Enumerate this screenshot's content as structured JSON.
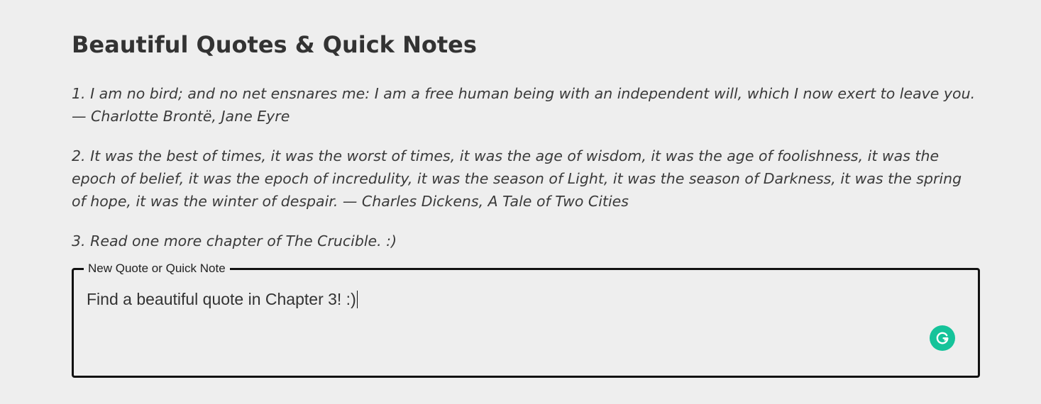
{
  "page": {
    "title": "Beautiful Quotes & Quick Notes"
  },
  "quotes": [
    {
      "number": "1.",
      "text": "I am no bird; and no net ensnares me: I am a free human being with an independent will, which I now exert to leave you. — Charlotte Brontë, Jane Eyre"
    },
    {
      "number": "2.",
      "text": "It was the best of times, it was the worst of times, it was the age of wisdom, it was the age of foolishness, it was the epoch of belief, it was the epoch of incredulity, it was the season of Light, it was the season of Darkness, it was the spring of hope, it was the winter of despair. — Charles Dickens, A Tale of Two Cities"
    },
    {
      "number": "3.",
      "text": "Read one more chapter of The Crucible. :)"
    }
  ],
  "note_form": {
    "legend": "New Quote or Quick Note",
    "value": "Find a beautiful quote in Chapter 3! :)"
  },
  "icons": {
    "grammarly": "grammarly-icon"
  },
  "colors": {
    "background": "#eeeeee",
    "text": "#333333",
    "border": "#111111",
    "grammarly": "#15c39a"
  }
}
